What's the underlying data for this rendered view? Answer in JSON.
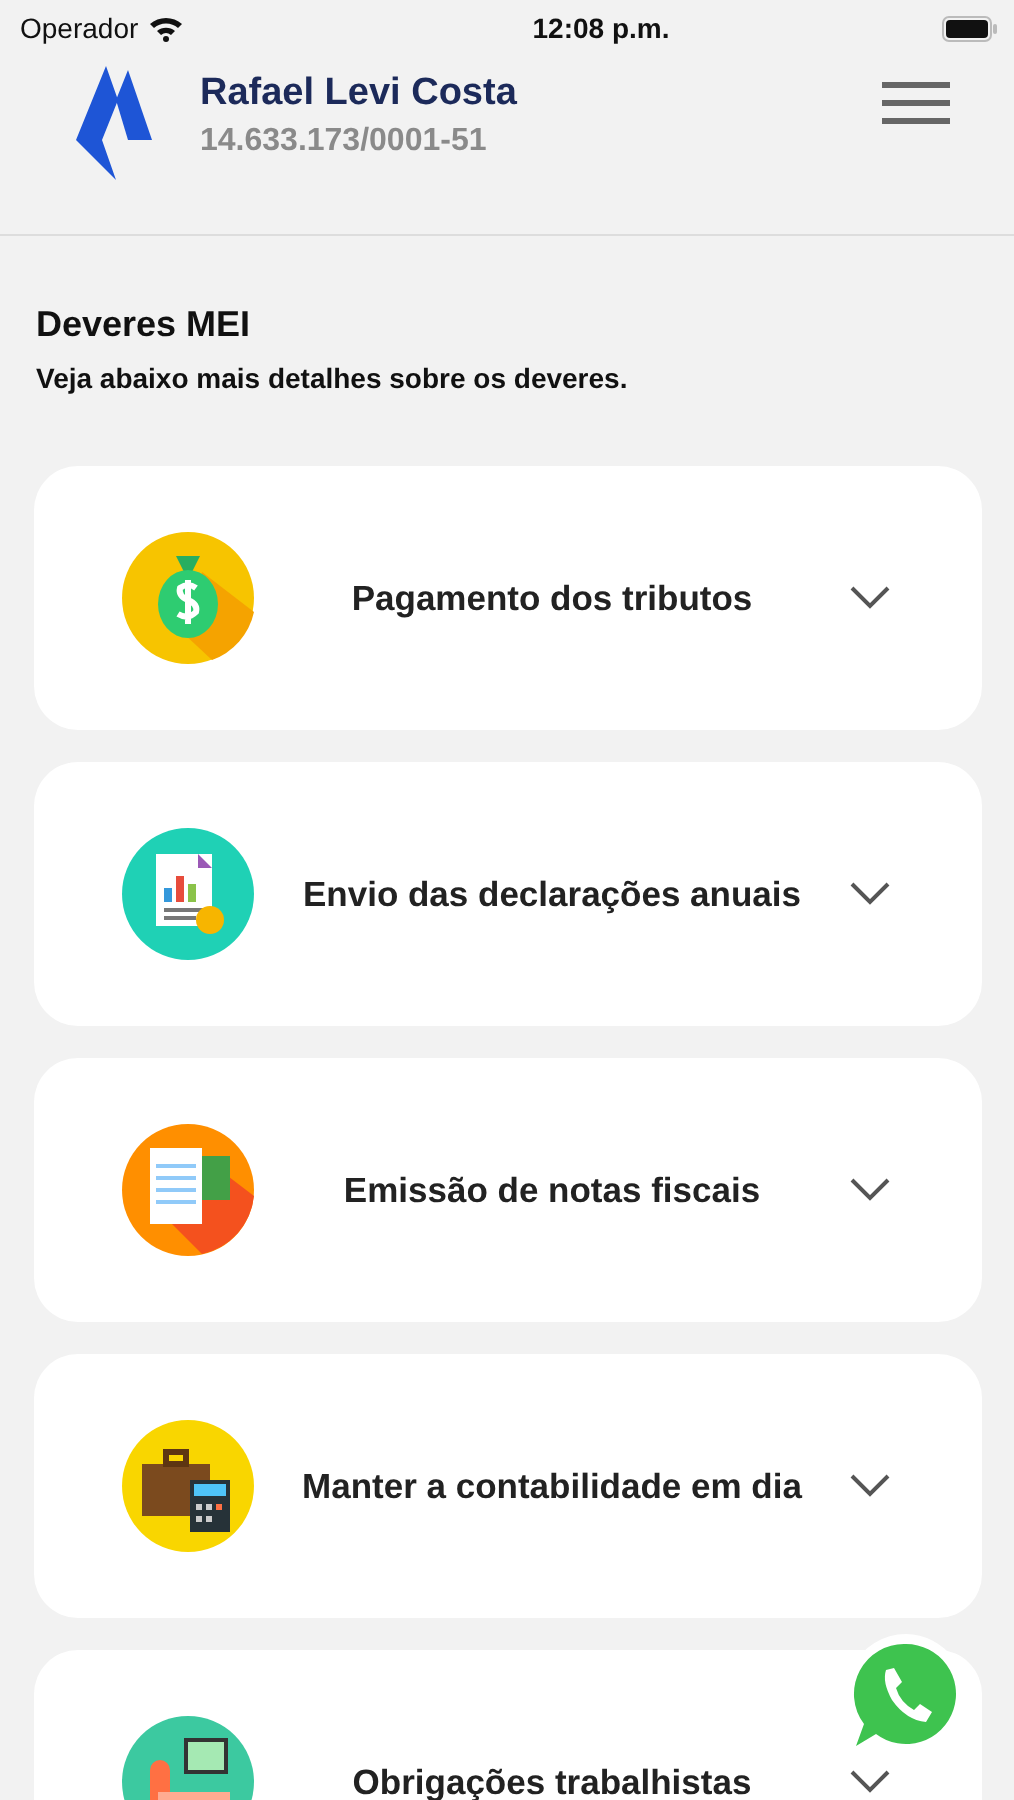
{
  "status_bar": {
    "carrier": "Operador",
    "time": "12:08 p.m."
  },
  "header": {
    "name": "Rafael Levi Costa",
    "document": "14.633.173/0001-51"
  },
  "section": {
    "title": "Deveres MEI",
    "subtitle": "Veja abaixo mais detalhes sobre os deveres."
  },
  "items": [
    {
      "label": "Pagamento dos tributos",
      "kind": "money",
      "expanded": false
    },
    {
      "label": "Envio das declarações anuais",
      "kind": "report",
      "expanded": false
    },
    {
      "label": "Emissão de notas fiscais",
      "kind": "invoice",
      "expanded": false
    },
    {
      "label": "Manter a contabilidade em dia",
      "kind": "accounting",
      "expanded": false
    },
    {
      "label": "Obrigações trabalhistas",
      "kind": "labor",
      "expanded": false
    }
  ]
}
